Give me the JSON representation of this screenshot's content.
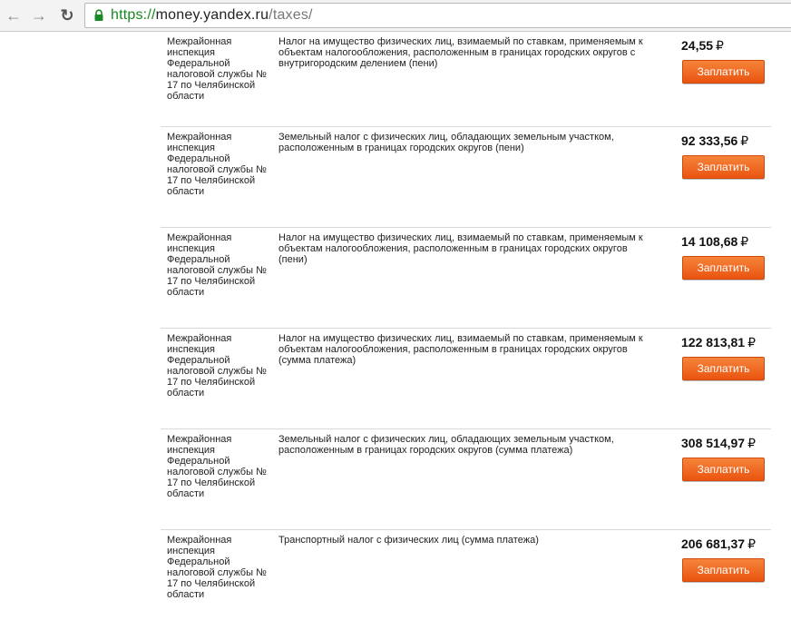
{
  "browser": {
    "url_scheme": "https://",
    "url_host": "money.yandex.ru",
    "url_path": "/taxes/"
  },
  "currency_symbol": "₽",
  "rows": [
    {
      "org": "Межрайонная инспекция Федеральной налоговой службы № 17 по Челябинской области",
      "description": "Налог на имущество физических лиц, взимаемый по ставкам, применяемым к объектам налогообложения, расположенным в границах городских округов с внутригородским делением (пени)",
      "amount": "24,55",
      "button": "Заплатить"
    },
    {
      "org": "Межрайонная инспекция Федеральной налоговой службы № 17 по Челябинской области",
      "description": "Земельный налог с физических лиц, обладающих земельным участком, расположенным в границах городских округов (пени)",
      "amount": "92 333,56",
      "button": "Заплатить"
    },
    {
      "org": "Межрайонная инспекция Федеральной налоговой службы № 17 по Челябинской области",
      "description": "Налог на имущество физических лиц, взимаемый по ставкам, применяемым к объектам налогообложения, расположенным в границах городских округов (пени)",
      "amount": "14 108,68",
      "button": "Заплатить"
    },
    {
      "org": "Межрайонная инспекция Федеральной налоговой службы № 17 по Челябинской области",
      "description": "Налог на имущество физических лиц, взимаемый по ставкам, применяемым к объектам налогообложения, расположенным в границах городских округов (сумма платежа)",
      "amount": "122 813,81",
      "button": "Заплатить"
    },
    {
      "org": "Межрайонная инспекция Федеральной налоговой службы № 17 по Челябинской области",
      "description": "Земельный налог с физических лиц, обладающих земельным участком, расположенным в границах городских округов (сумма платежа)",
      "amount": "308 514,97",
      "button": "Заплатить"
    },
    {
      "org": "Межрайонная инспекция Федеральной налоговой службы № 17 по Челябинской области",
      "description": "Транспортный налог с физических лиц (сумма платежа)",
      "amount": "206 681,37",
      "button": "Заплатить"
    }
  ]
}
